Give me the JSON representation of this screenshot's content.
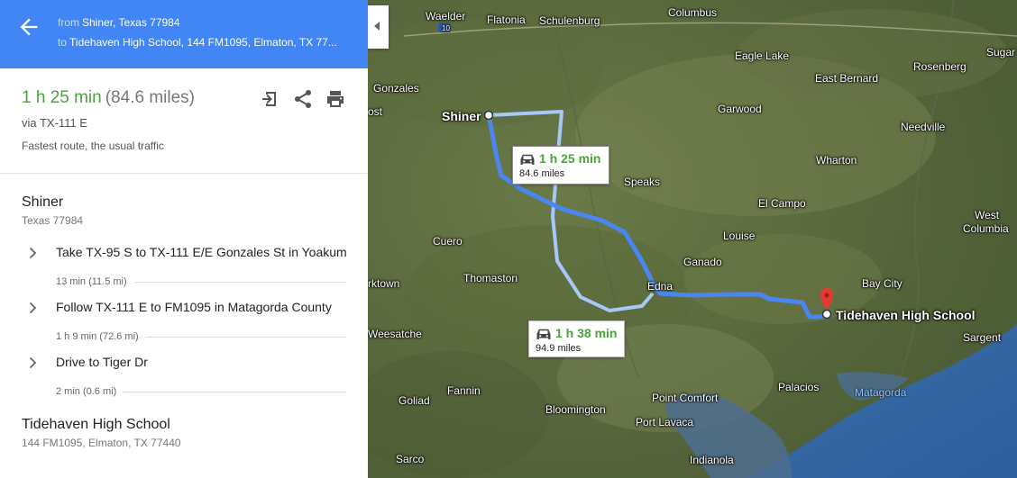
{
  "header": {
    "from_prefix": "from",
    "from": "Shiner, Texas 77984",
    "to_prefix": "to",
    "to": "Tidehaven High School, 144 FM1095, Elmaton, TX 77..."
  },
  "summary": {
    "time": "1 h 25 min",
    "distance": "(84.6 miles)",
    "via": "via TX-111 E",
    "note": "Fastest route, the usual traffic",
    "actions": [
      "send-to-device-icon",
      "share-icon",
      "print-icon"
    ]
  },
  "origin": {
    "name": "Shiner",
    "address": "Texas 77984"
  },
  "steps": [
    {
      "text": "Take TX-95 S to TX-111 E/E Gonzales St in Yoakum",
      "meta": "13 min (11.5 mi)"
    },
    {
      "text": "Follow TX-111 E to FM1095 in Matagorda County",
      "meta": "1 h 9 min (72.6 mi)"
    },
    {
      "text": "Drive to Tiger Dr",
      "meta": "2 min (0.6 mi)"
    }
  ],
  "destination": {
    "name": "Tidehaven High School",
    "address": "144 FM1095, Elmaton, TX 77440"
  },
  "map": {
    "routes": [
      {
        "time": "1 h 25 min",
        "distance": "84.6 miles",
        "selected": true
      },
      {
        "time": "1 h 38 min",
        "distance": "94.9 miles",
        "selected": false
      }
    ],
    "markers": {
      "origin": "Shiner",
      "destination": "Tidehaven High School"
    },
    "labels": {
      "waelder": "Waelder",
      "flatonia": "Flatonia",
      "schulenburg": "Schulenburg",
      "columbus": "Columbus",
      "sugar_land": "Sugar Lan",
      "eagle_lake": "Eagle Lake",
      "east_bernard": "East Bernard",
      "rosenberg": "Rosenberg",
      "gonzales": "Gonzales",
      "ost": "ost",
      "garwood": "Garwood",
      "needville": "Needville",
      "wharton": "Wharton",
      "speaks": "Speaks",
      "el_campo": "El Campo",
      "west_columbia_1": "West",
      "west_columbia_2": "Columbia",
      "cuero": "Cuero",
      "louise": "Louise",
      "ganado": "Ganado",
      "thomaston": "Thomaston",
      "kirktown": "rktown",
      "edna": "Edna",
      "bay_city": "Bay City",
      "sargent": "Sargent",
      "weesatche": "Weesatche",
      "goliad": "Goliad",
      "fannin": "Fannin",
      "point_comfort": "Point Comfort",
      "palacios": "Palacios",
      "matagorda": "Matagorda",
      "bloomington": "Bloomington",
      "port_lavaca": "Port Lavaca",
      "sarco": "Sarco",
      "indianola": "Indianola",
      "highway": "10"
    },
    "colors": {
      "route": "#4b86f0",
      "alt_route": "#a8c7fa",
      "header": "#4285f4",
      "time_green": "#4aa23c"
    }
  }
}
